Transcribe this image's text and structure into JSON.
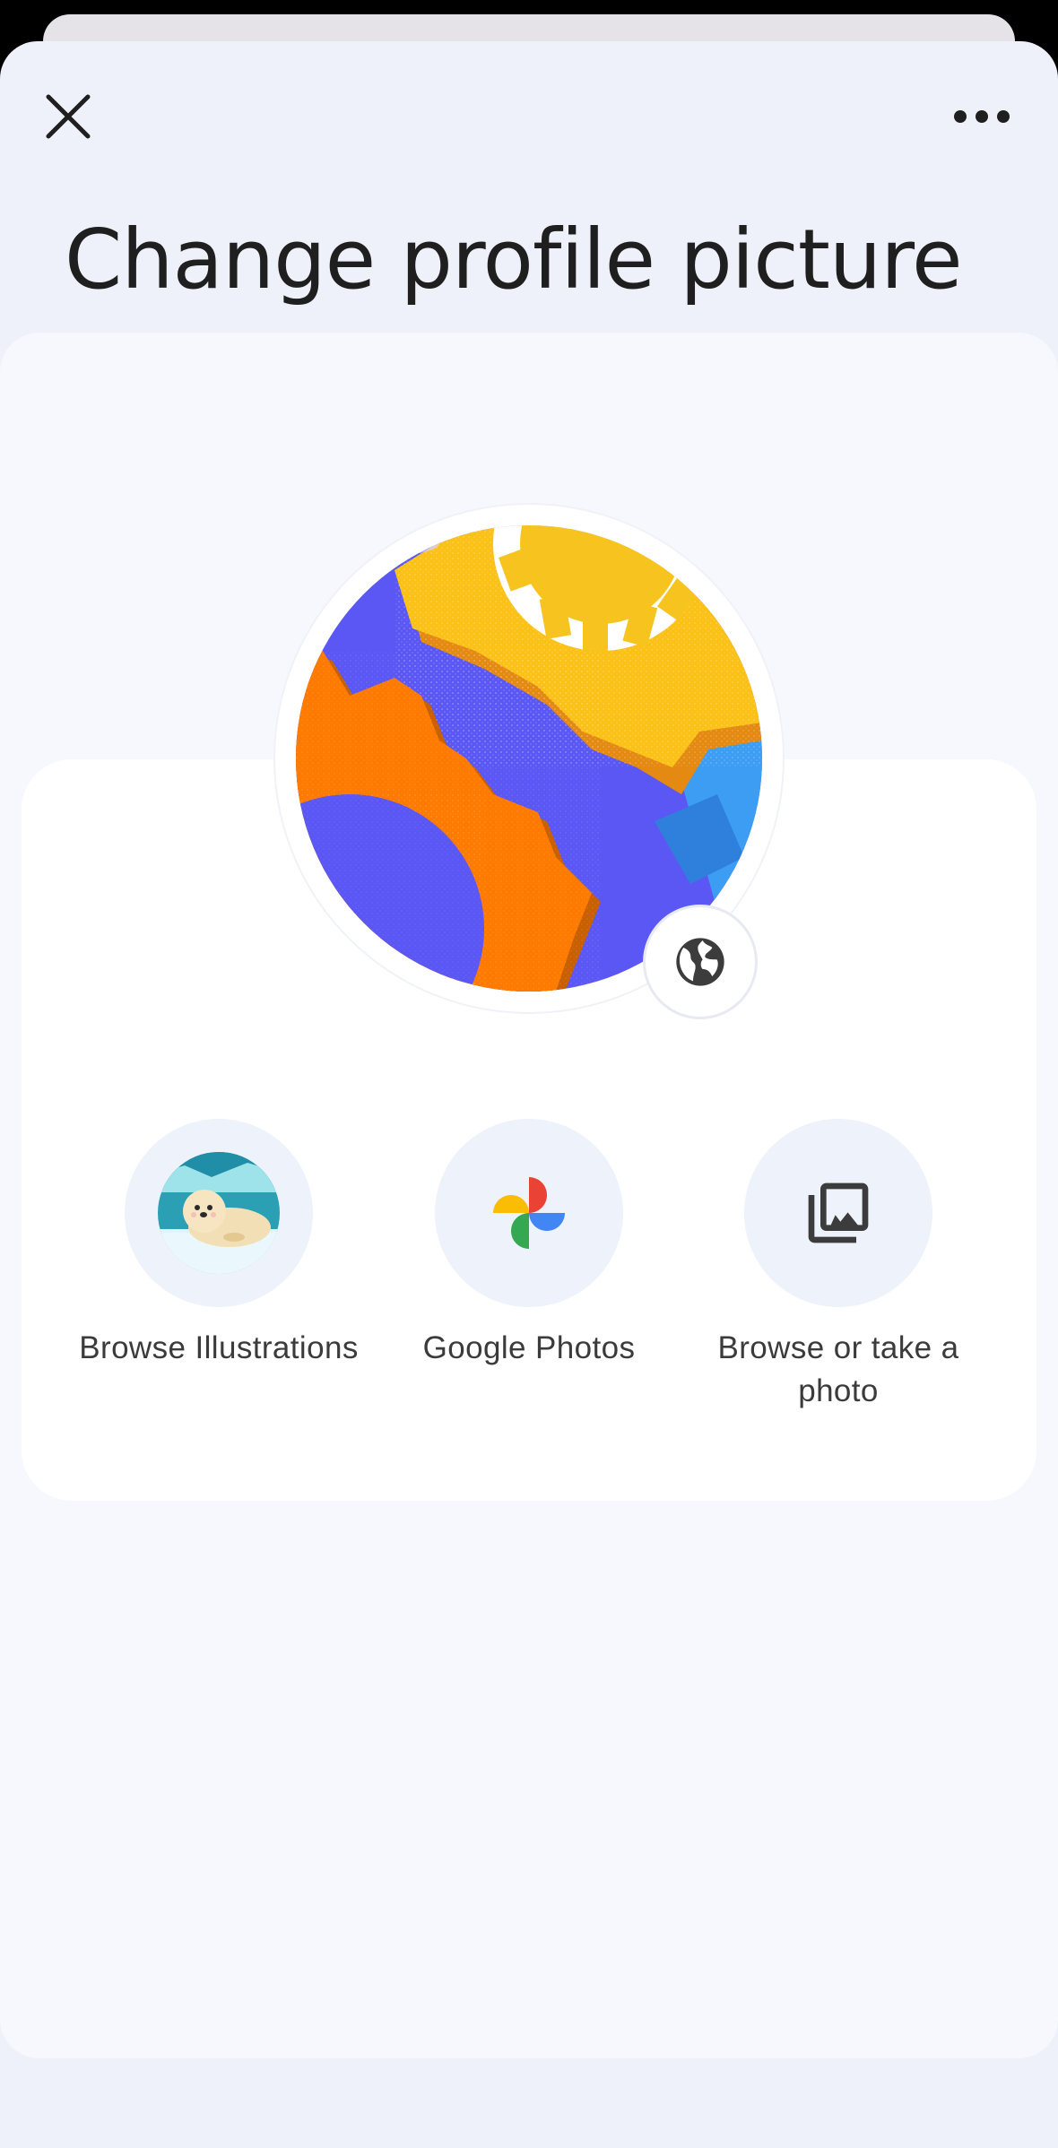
{
  "header": {
    "title": "Change profile picture",
    "close_icon": "close-icon",
    "more_icon": "more-horizontal-icon"
  },
  "avatar": {
    "badge_icon": "globe-icon",
    "colors": {
      "purple": "#5b57f4",
      "orange": "#ff7a00",
      "yellow": "#fbc117",
      "blue": "#3b9bf0"
    }
  },
  "options": [
    {
      "label": "Browse Illustrations",
      "icon": "seal-illustration-icon"
    },
    {
      "label": "Google Photos",
      "icon": "google-photos-icon"
    },
    {
      "label": "Browse or take a photo",
      "icon": "photo-library-icon"
    }
  ]
}
